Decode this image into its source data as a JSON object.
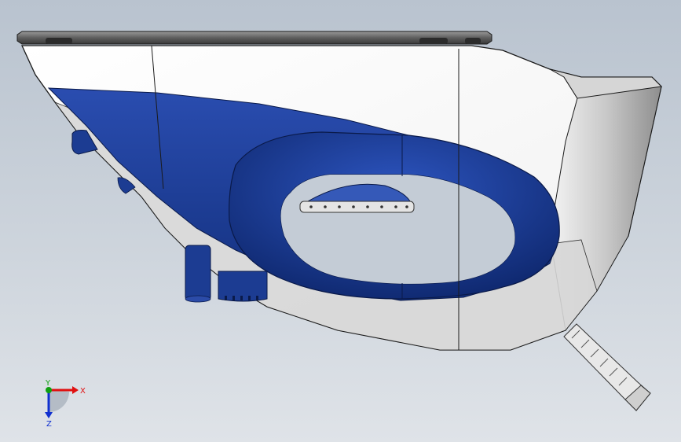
{
  "viewport": {
    "background_top": "#b9c3cf",
    "background_bottom": "#dfe3e8"
  },
  "model": {
    "body_color": "#ffffff",
    "accent_color": "#1f3f94",
    "accent_dark": "#0f2566",
    "edge_color": "#1a1a1a",
    "grey_color": "#c8c8c8",
    "soleplate_color": "#6f6f6f"
  },
  "triad": {
    "x_label": "X",
    "y_label": "Y",
    "z_label": "Z",
    "x_color": "#e01010",
    "y_color": "#10a010",
    "z_color": "#1030d0"
  }
}
